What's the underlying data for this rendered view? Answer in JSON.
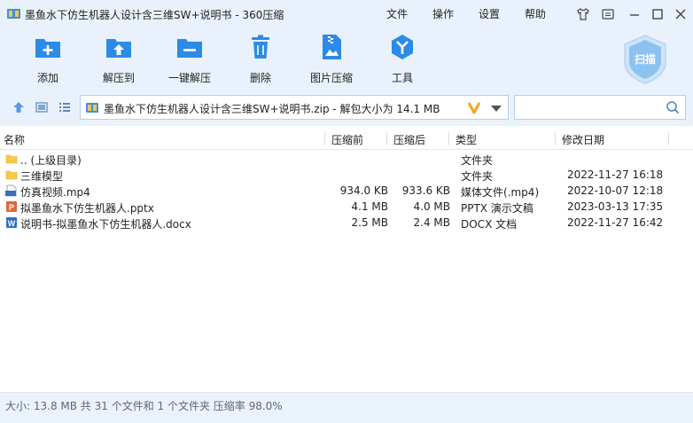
{
  "window": {
    "title": "墨鱼水下仿生机器人设计含三维SW+说明书 - 360压缩",
    "menus": [
      "文件",
      "操作",
      "设置",
      "帮助"
    ]
  },
  "toolbar": {
    "items": [
      {
        "label": "添加",
        "icon": "add-icon"
      },
      {
        "label": "解压到",
        "icon": "extract-icon"
      },
      {
        "label": "一键解压",
        "icon": "one-click-extract-icon"
      },
      {
        "label": "删除",
        "icon": "delete-icon"
      },
      {
        "label": "图片压缩",
        "icon": "image-compress-icon"
      },
      {
        "label": "工具",
        "icon": "tools-icon"
      }
    ],
    "scan_label": "扫描"
  },
  "address": {
    "path": "墨鱼水下仿生机器人设计含三维SW+说明书.zip - 解包大小为 14.1 MB"
  },
  "columns": {
    "name": "名称",
    "packed": "压缩前",
    "unpacked": "压缩后",
    "type": "类型",
    "modified": "修改日期"
  },
  "files": [
    {
      "name": ".. (上级目录)",
      "size": "",
      "packed": "",
      "type": "文件夹",
      "modified": "",
      "icon": "folder-icon"
    },
    {
      "name": "三维模型",
      "size": "",
      "packed": "",
      "type": "文件夹",
      "modified": "2022-11-27 16:18",
      "icon": "folder-icon"
    },
    {
      "name": "仿真视频.mp4",
      "size": "934.0 KB",
      "packed": "933.6 KB",
      "type": "媒体文件(.mp4)",
      "modified": "2022-10-07 12:18",
      "icon": "mp4-file-icon"
    },
    {
      "name": "拟墨鱼水下仿生机器人.pptx",
      "size": "4.1 MB",
      "packed": "4.0 MB",
      "type": "PPTX 演示文稿",
      "modified": "2023-03-13 17:35",
      "icon": "pptx-file-icon"
    },
    {
      "name": "说明书-拟墨鱼水下仿生机器人.docx",
      "size": "2.5 MB",
      "packed": "2.4 MB",
      "type": "DOCX 文档",
      "modified": "2022-11-27 16:42",
      "icon": "docx-file-icon"
    }
  ],
  "status": {
    "text": "大小: 13.8 MB 共 31 个文件和 1 个文件夹 压缩率 98.0%"
  },
  "colors": {
    "accent": "#2b8be6",
    "chrome_bg": "#e9f2fc",
    "folder": "#f7c948"
  }
}
